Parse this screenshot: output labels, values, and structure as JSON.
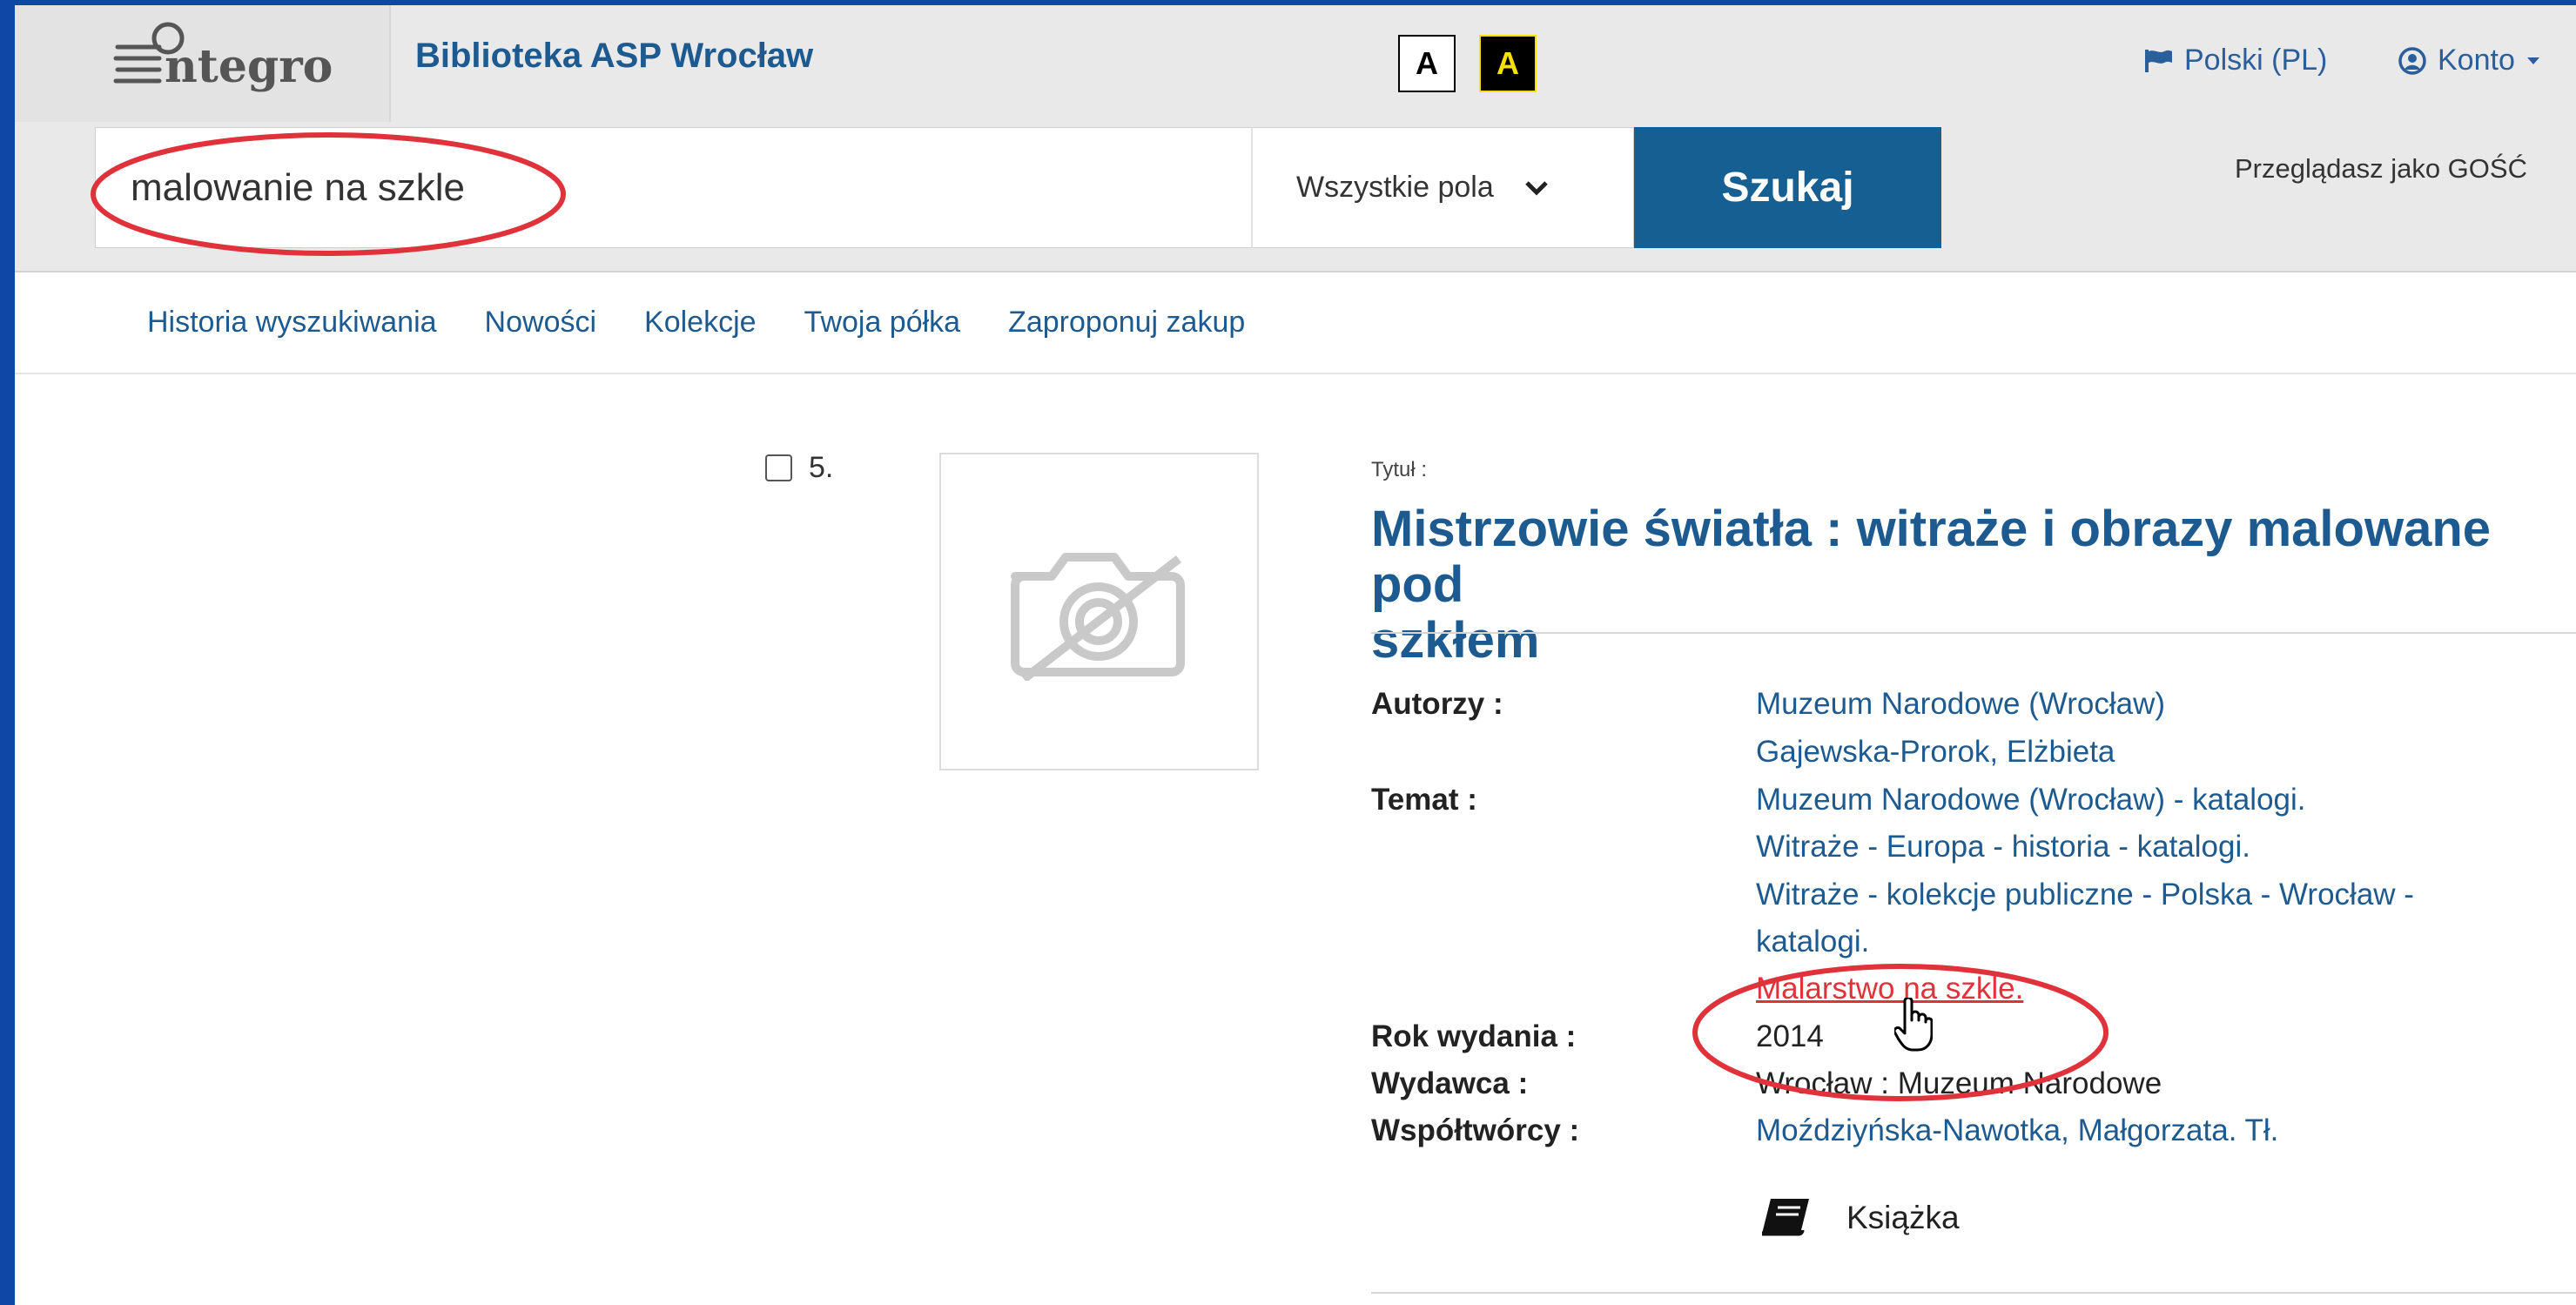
{
  "header": {
    "brand": "Biblioteka ASP Wrocław",
    "contrast_normal": "A",
    "contrast_high": "A",
    "language": "Polski (PL)",
    "account": "Konto",
    "guest_text": "Przeglądasz jako GOŚĆ"
  },
  "search": {
    "query": "malowanie na szkle",
    "scope": "Wszystkie pola",
    "button": "Szukaj"
  },
  "nav": [
    "Historia wyszukiwania",
    "Nowości",
    "Kolekcje",
    "Twoja półka",
    "Zaproponuj zakup"
  ],
  "record": {
    "rank": "5.",
    "title_label": "Tytuł :",
    "title_line1": "Mistrzowie światła : witraże i obrazy malowane pod",
    "title_line2": "szkłem",
    "authors_label": "Autorzy :",
    "authors": [
      "Muzeum Narodowe (Wrocław)",
      "Gajewska-Prorok, Elżbieta"
    ],
    "subject_label": "Temat :",
    "subjects": [
      "Muzeum Narodowe (Wrocław) - katalogi.",
      "Witraże - Europa - historia - katalogi.",
      "Witraże - kolekcje publiczne - Polska - Wrocław -",
      "katalogi.",
      "Malarstwo na szkle."
    ],
    "year_label": "Rok wydania :",
    "year": "2014",
    "publisher_label": "Wydawca :",
    "publisher": "Wrocław : Muzeum Narodowe",
    "contributors_label": "Współtwórcy :",
    "contributors": "Moździyńska-Nawotka, Małgorzata. Tł.",
    "type": "Książka"
  },
  "colors": {
    "outer_border": "#0f47a6",
    "link": "#1d5a8f",
    "search_button": "#155f93",
    "annotation": "#e0323a"
  }
}
